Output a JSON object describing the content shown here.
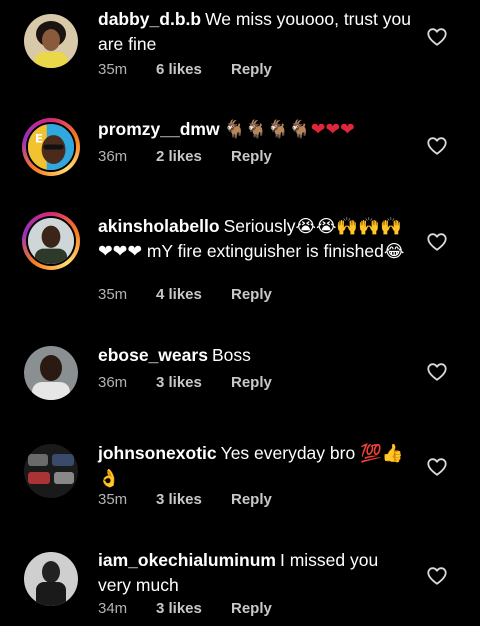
{
  "comments": [
    {
      "username": "dabby_d.b.b",
      "text": "We miss youooo, trust you are fine",
      "time": "35m",
      "likes": "6 likes",
      "reply": "Reply",
      "avatar_icon": "woman-avatar-icon"
    },
    {
      "username": "promzy__dmw",
      "text": "🐐🐐🐐🐐❤❤❤",
      "time": "36m",
      "likes": "2 likes",
      "reply": "Reply",
      "avatar_icon": "cartoon-avatar-icon"
    },
    {
      "username": "akinsholabello",
      "text": "Seriously😭😭🙌🙌🙌❤❤❤ mY fire extinguisher is finished😂",
      "time": "35m",
      "likes": "4 likes",
      "reply": "Reply",
      "avatar_icon": "man-avatar-icon"
    },
    {
      "username": "ebose_wears",
      "text": "Boss",
      "time": "36m",
      "likes": "3 likes",
      "reply": "Reply",
      "avatar_icon": "man-avatar-icon"
    },
    {
      "username": "johnsonexotic",
      "text": "Yes everyday bro 💯👍👌",
      "time": "35m",
      "likes": "3 likes",
      "reply": "Reply",
      "avatar_icon": "cars-avatar-icon"
    },
    {
      "username": "iam_okechialuminum",
      "text": "I missed you very much",
      "time": "34m",
      "likes": "3 likes",
      "reply": "Reply",
      "avatar_icon": "man-avatar-icon"
    }
  ],
  "colors": {
    "background": "#000000",
    "text": "#ffffff",
    "meta": "#b3b3b3",
    "heart_icon": "#d9d9d9"
  }
}
